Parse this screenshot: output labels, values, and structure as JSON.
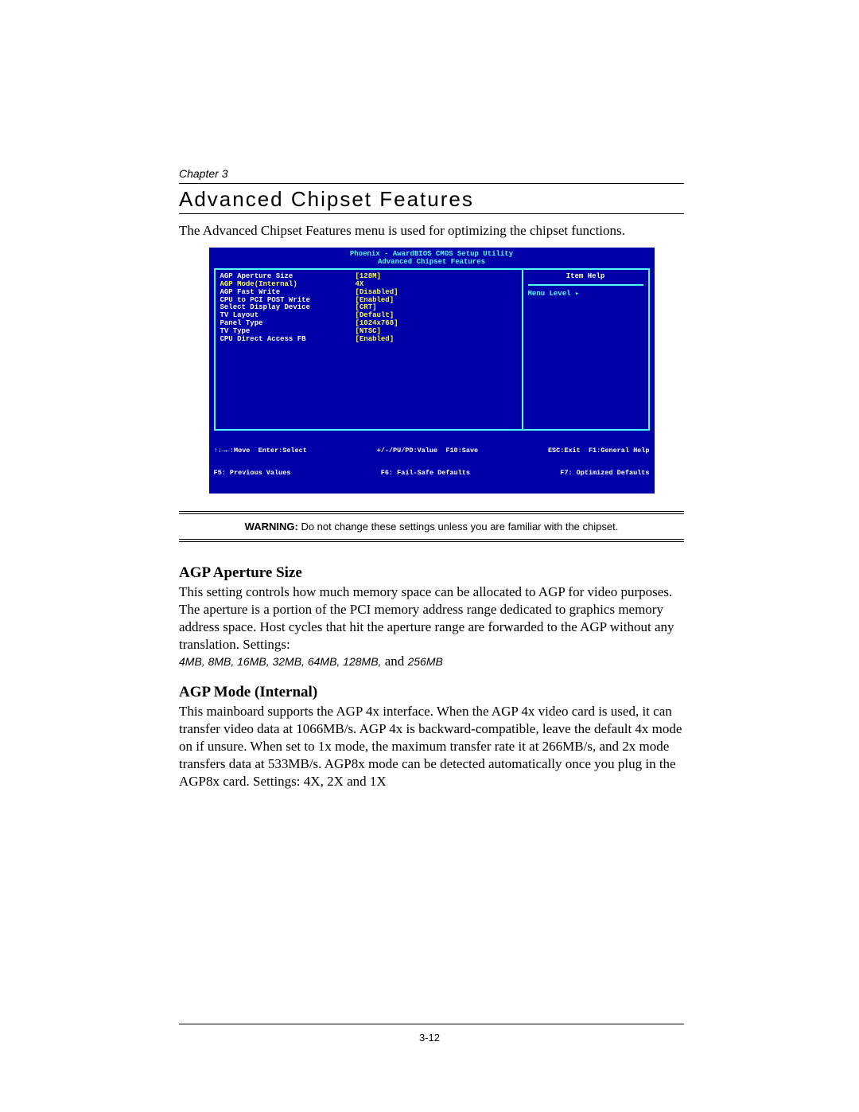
{
  "chapter": "Chapter 3",
  "title": "Advanced Chipset Features",
  "intro": "The Advanced Chipset Features menu is used for optimizing the chipset functions.",
  "bios": {
    "header1": "Phoenix - AwardBIOS CMOS Setup Utility",
    "header2": "Advanced Chipset Features",
    "items": [
      {
        "label": "AGP Aperture Size",
        "value": "[128M]",
        "selected": false
      },
      {
        "label": "AGP Mode(Internal)",
        "value": "4X",
        "selected": true
      },
      {
        "label": "AGP Fast Write",
        "value": "[Disabled]",
        "selected": false
      },
      {
        "label": "CPU to PCI POST Write",
        "value": "[Enabled]",
        "selected": false
      },
      {
        "label": "Select Display Device",
        "value": "[CRT]",
        "selected": false
      },
      {
        "label": "TV Layout",
        "value": "[Default]",
        "selected": false
      },
      {
        "label": "Panel Type",
        "value": "[1024x768]",
        "selected": false
      },
      {
        "label": "TV Type",
        "value": "[NTSC]",
        "selected": false
      },
      {
        "label": "CPU Direct Access FB",
        "value": "[Enabled]",
        "selected": false
      }
    ],
    "help_title": "Item Help",
    "menu_level": "Menu Level    ▸",
    "footer1a": "↑↓→←:Move  Enter:Select",
    "footer1b": "+/-/PU/PD:Value  F10:Save",
    "footer1c": "ESC:Exit  F1:General Help",
    "footer2a": "F5: Previous Values",
    "footer2b": "F6: Fail-Safe Defaults",
    "footer2c": "F7: Optimized Defaults"
  },
  "warning_label": "WARNING:",
  "warning_text": " Do not change these settings unless you are familiar with the chipset.",
  "s1": {
    "head": "AGP Aperture Size",
    "body": "This setting controls how much memory space can be allocated to AGP for video purposes. The aperture is a portion of the PCI memory address range dedicated to graphics memory address space. Host cycles that hit the aperture range are forwarded to the AGP without any translation. Settings:",
    "opts": "4MB, 8MB, 16MB, 32MB, 64MB, 128MB,",
    "opts_tail": " and ",
    "opts_last": "256MB"
  },
  "s2": {
    "head": "AGP Mode (Internal)",
    "body": "This mainboard supports the AGP 4x interface. When the AGP 4x video card is used, it can transfer video data at 1066MB/s. AGP 4x is backward-compatible, leave the default 4x mode on if unsure. When set to 1x mode, the maximum transfer rate it at 266MB/s, and 2x mode transfers data at 533MB/s. AGP8x mode can be detected automatically once you plug in the AGP8x card. Settings: ",
    "o1": "4X",
    "c1": ", ",
    "o2": "2X",
    "c2": " and ",
    "o3": "1X"
  },
  "pagenum": "3-12"
}
